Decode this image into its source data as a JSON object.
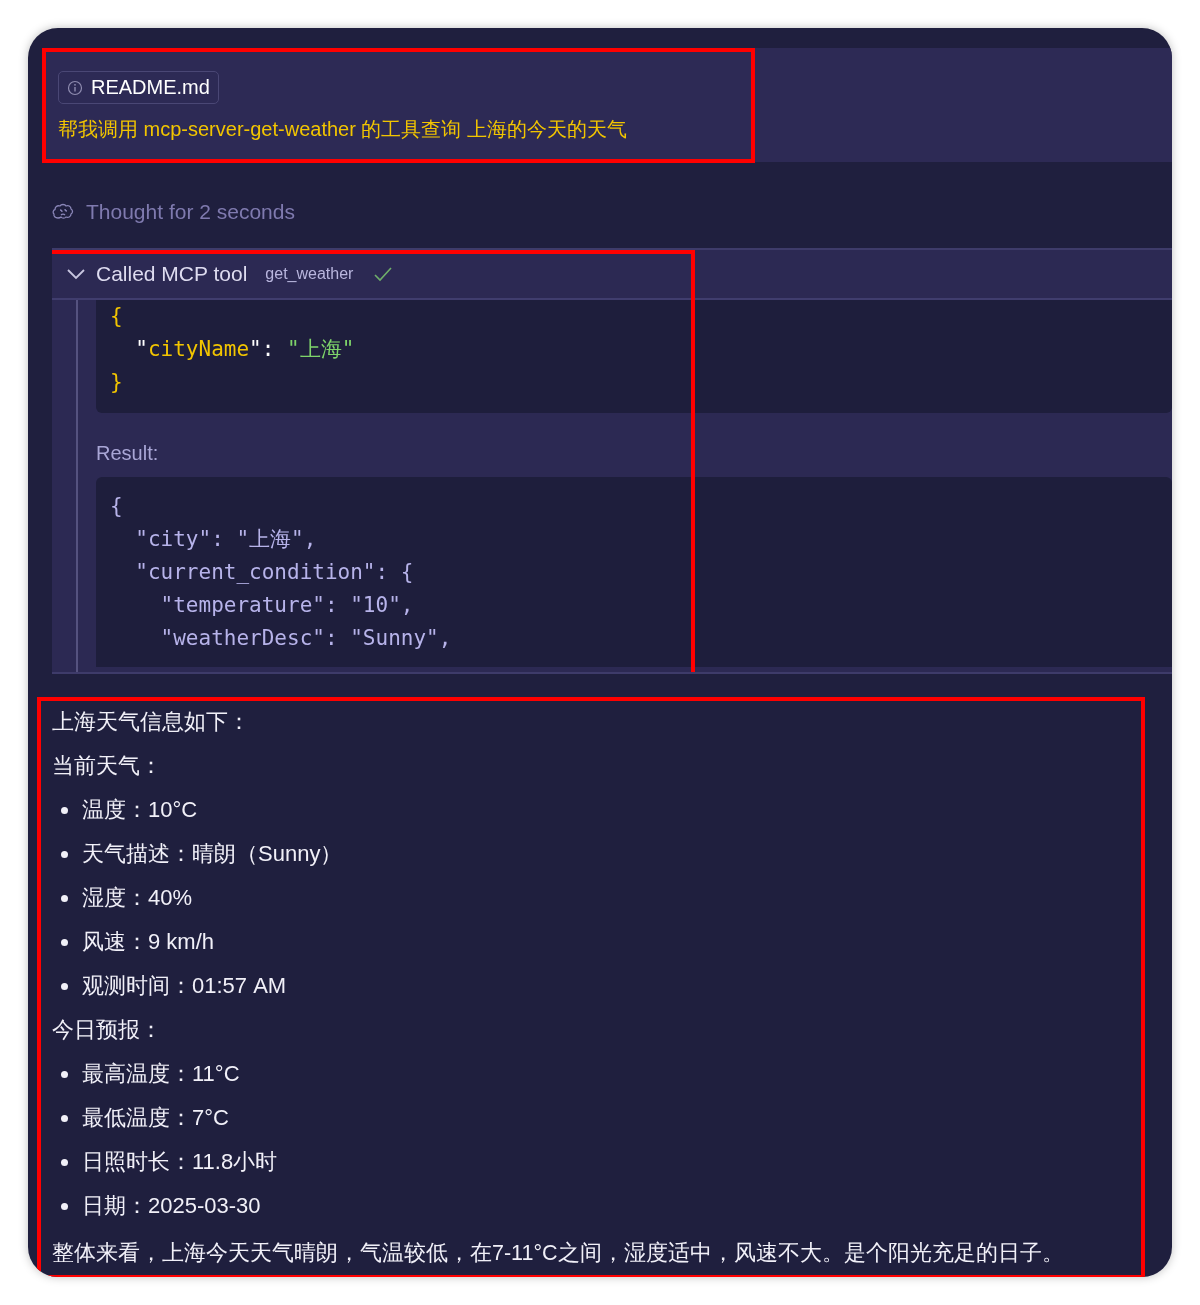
{
  "user_message": {
    "attachment": "README.md",
    "text": "帮我调用 mcp-server-get-weather 的工具查询 上海的今天的天气",
    "highlighted": true
  },
  "thought": {
    "text": "Thought for 2 seconds"
  },
  "tool_call": {
    "title": "Called MCP tool",
    "tool": "get_weather",
    "expanded": true,
    "succeeded": true,
    "highlighted": true,
    "input": [
      [
        {
          "kind": "punct",
          "text": "{"
        }
      ],
      [
        {
          "kind": "plain",
          "text": "  \""
        },
        {
          "kind": "key",
          "text": "cityName"
        },
        {
          "kind": "plain",
          "text": "\": "
        },
        {
          "kind": "string",
          "text": "\"上海\""
        }
      ],
      [
        {
          "kind": "punct",
          "text": "}"
        }
      ]
    ],
    "result_label": "Result:",
    "result": [
      "{",
      "  \"city\": \"上海\",",
      "  \"current_condition\": {",
      "    \"temperature\": \"10\",",
      "    \"weatherDesc\": \"Sunny\","
    ]
  },
  "answer": {
    "highlighted": true,
    "blocks": [
      {
        "kind": "heading",
        "text": "上海天气信息如下："
      },
      {
        "kind": "heading",
        "text": "当前天气："
      },
      {
        "kind": "bullet",
        "text": "温度：10°C"
      },
      {
        "kind": "bullet",
        "text": "天气描述：晴朗（Sunny）"
      },
      {
        "kind": "bullet",
        "text": "湿度：40%"
      },
      {
        "kind": "bullet",
        "text": "风速：9 km/h"
      },
      {
        "kind": "bullet",
        "text": "观测时间：01:57 AM"
      },
      {
        "kind": "heading",
        "text": "今日预报："
      },
      {
        "kind": "bullet",
        "text": "最高温度：11°C"
      },
      {
        "kind": "bullet",
        "text": "最低温度：7°C"
      },
      {
        "kind": "bullet",
        "text": "日照时长：11.8小时"
      },
      {
        "kind": "bullet",
        "text": "日期：2025-03-30"
      },
      {
        "kind": "paragraph",
        "text": "整体来看，上海今天天气晴朗，气温较低，在7-11°C之间，湿度适中，风速不大。是个阳光充足的日子。"
      }
    ]
  }
}
